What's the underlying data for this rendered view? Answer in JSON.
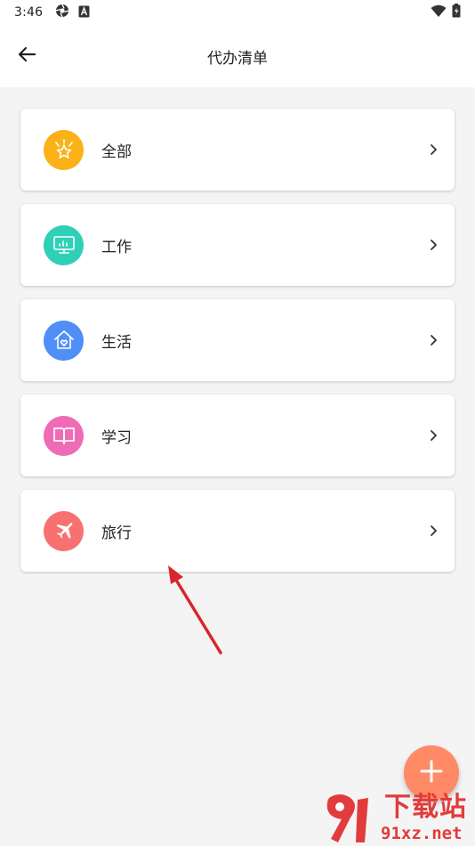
{
  "status_bar": {
    "time": "3:46"
  },
  "header": {
    "title": "代办清单",
    "back_icon": "arrow-left-icon"
  },
  "categories": [
    {
      "label": "全部",
      "icon": "crown-star-icon",
      "color": "#fbb117"
    },
    {
      "label": "工作",
      "icon": "monitor-chart-icon",
      "color": "#2fd0b8"
    },
    {
      "label": "生活",
      "icon": "home-heart-icon",
      "color": "#4f8ff7"
    },
    {
      "label": "学习",
      "icon": "book-icon",
      "color": "#f06bb6"
    },
    {
      "label": "旅行",
      "icon": "airplane-icon",
      "color": "#f87171"
    }
  ],
  "fab": {
    "icon": "plus-icon",
    "color": "#ff8a65"
  },
  "watermark": {
    "top": "下载站",
    "bottom": "91xz.net"
  },
  "colors": {
    "annotation_arrow": "#d9262c",
    "page_background": "#f4f4f4"
  }
}
